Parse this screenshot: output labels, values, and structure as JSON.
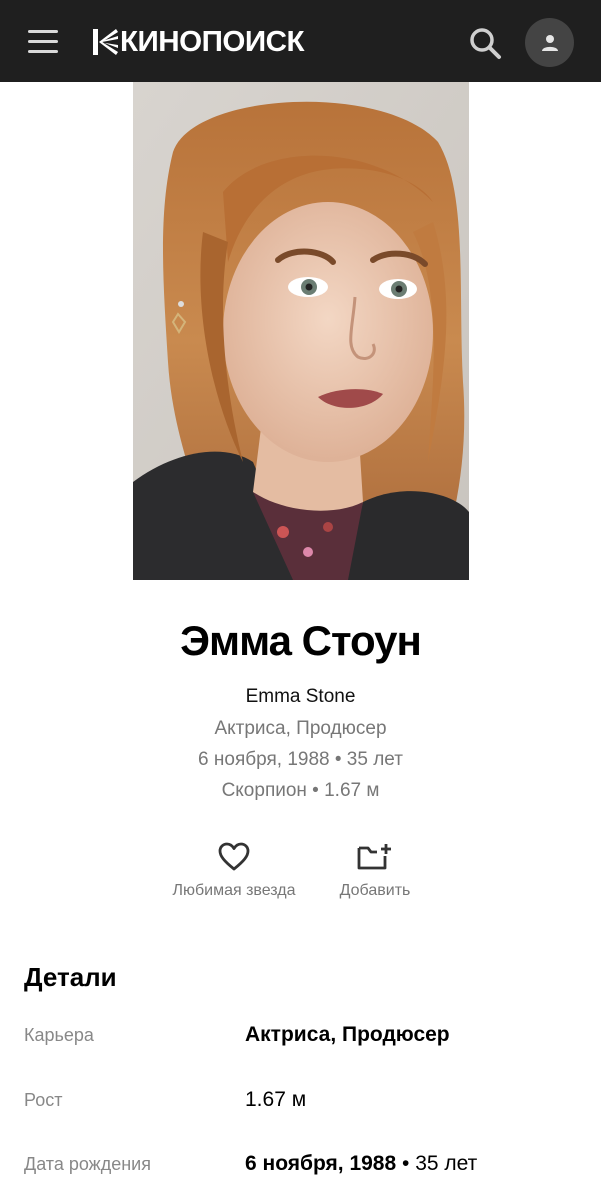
{
  "header": {
    "logo_text": "КИНОПОИСК",
    "menu_icon": "hamburger-menu-icon",
    "search_icon": "search-icon",
    "avatar_icon": "user-icon",
    "background": "#1f1f1f"
  },
  "person": {
    "photo_alt": "Эмма Стоун",
    "name": "Эмма Стоун",
    "original_name": "Emma Stone",
    "roles": "Актриса, Продюсер",
    "birth_line": "6 ноября, 1988 • 35 лет",
    "sign_line": "Скорпион • 1.67 м"
  },
  "actions": {
    "favorite_label": "Любимая звезда",
    "add_label": "Добавить"
  },
  "details": {
    "title": "Детали",
    "career_label": "Карьера",
    "career_value": "Актриса, Продюсер",
    "height_label": "Рост",
    "height_value": "1.67 м",
    "birth_label": "Дата рождения",
    "birth_date": "6 ноября, 1988",
    "birth_age": " • 35 лет"
  }
}
